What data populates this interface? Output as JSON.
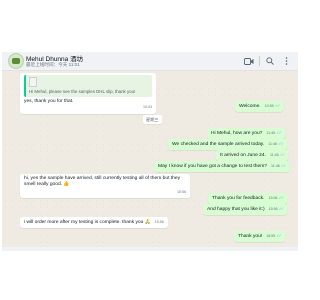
{
  "contact": {
    "name": "Mehul Dhunna 酒坊",
    "status": "最近上线时间：今天 11:01"
  },
  "header": {
    "icons": [
      "video-call-icon",
      "search-icon",
      "menu-dots-icon"
    ]
  },
  "date_divider": "星期三",
  "messages": [
    {
      "dir": "in",
      "quote": "Hi Mehul, please see the samples DHL slip, thank you!",
      "text": "yes, thank you for that.",
      "time": "10:43"
    },
    {
      "dir": "out",
      "text": "Welcome.",
      "time": "10:55"
    },
    {
      "dir": "out",
      "text": "Hi Mehul, how are you?",
      "time": "11:46"
    },
    {
      "dir": "out",
      "text": "We checked and the sample arrived today.",
      "time": "11:46"
    },
    {
      "dir": "out",
      "text": "It arrived on June 24.",
      "time": "11:46"
    },
    {
      "dir": "out",
      "text": "May I know if you have got a change to test them?",
      "time": "11:46"
    },
    {
      "dir": "in",
      "text": "hi, yes the sample have arrived, still currently testing all of them but they smell really good. 👍",
      "time": "15:56"
    },
    {
      "dir": "out",
      "text": "Thank you for feedback.",
      "time": "15:56"
    },
    {
      "dir": "out",
      "text": "And happy that you like it:)",
      "time": "15:56"
    },
    {
      "dir": "in",
      "text": "i will order more after my testing is complete. thank you 🙏",
      "time": "15:56"
    },
    {
      "dir": "out",
      "text": "Thank you!",
      "time": "18:59"
    }
  ],
  "colors": {
    "incoming": "#ffffff",
    "outgoing": "#d9fdd3",
    "chat_bg": "#efeae2",
    "read_ticks": "#53bdeb"
  }
}
